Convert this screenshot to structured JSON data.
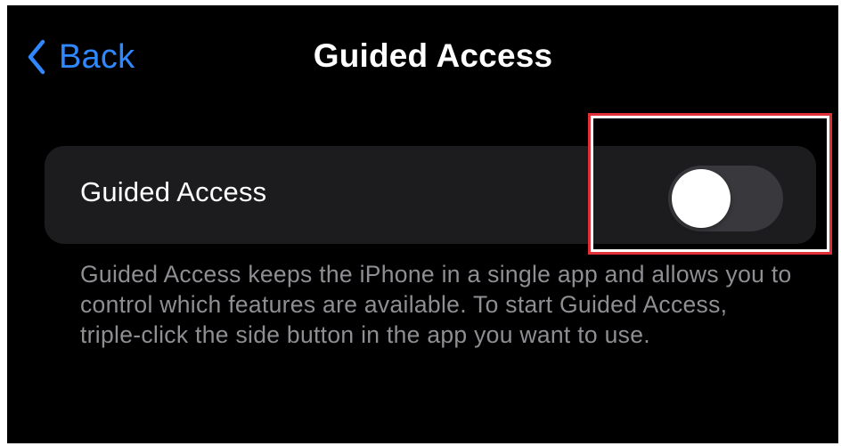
{
  "nav": {
    "back_label": "Back",
    "title": "Guided Access"
  },
  "setting": {
    "label": "Guided Access",
    "toggle_state": "off"
  },
  "footer": {
    "description": "Guided Access keeps the iPhone in a single app and allows you to control which features are available. To start Guided Access, triple-click the side button in the app you want to use."
  },
  "colors": {
    "accent": "#2f88ff",
    "background": "#000000",
    "row_background": "#1c1c1e",
    "toggle_off": "#39393d",
    "highlight": "#e0303a",
    "secondary_text": "#8e8e93"
  },
  "icons": {
    "back": "chevron-left-icon"
  }
}
